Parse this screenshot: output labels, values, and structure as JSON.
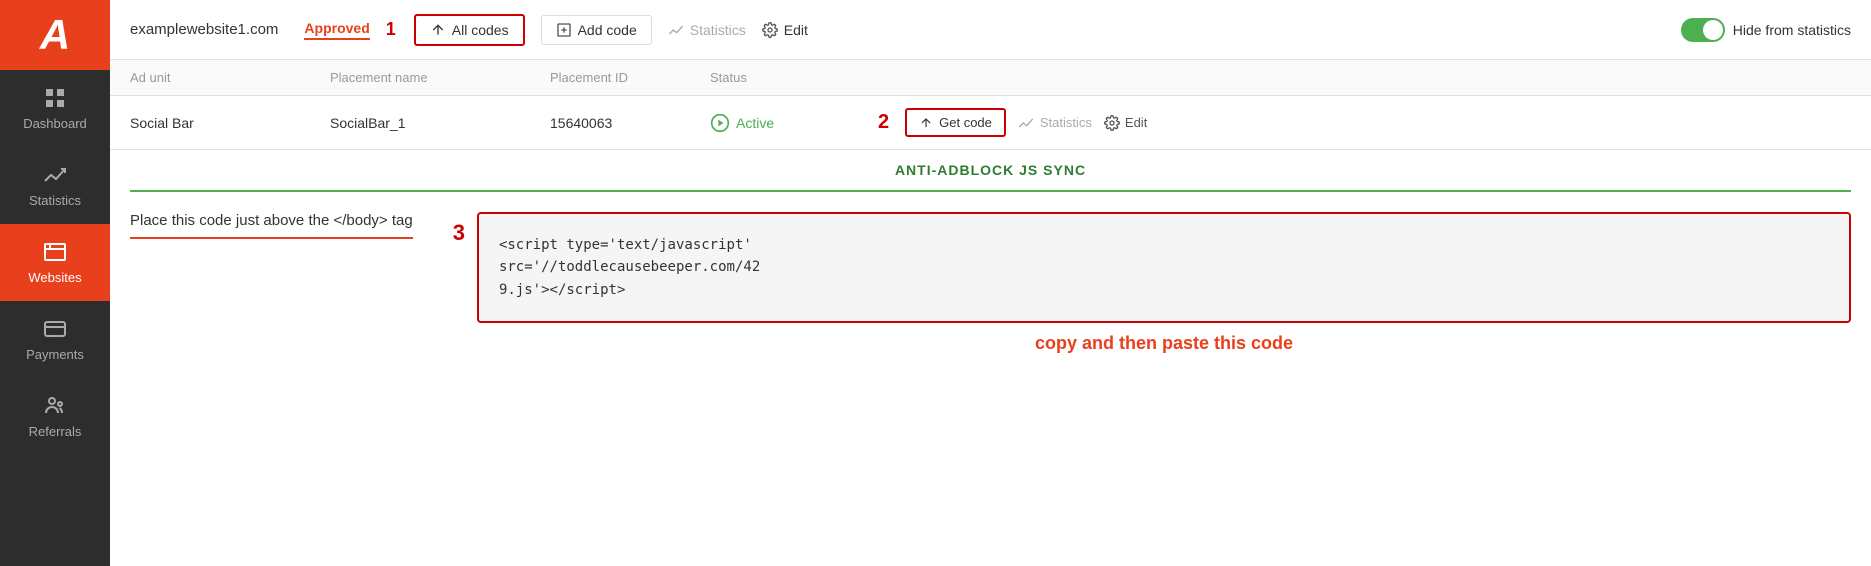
{
  "sidebar": {
    "logo": "A",
    "items": [
      {
        "id": "dashboard",
        "label": "Dashboard",
        "icon": "grid"
      },
      {
        "id": "statistics",
        "label": "Statistics",
        "icon": "chart"
      },
      {
        "id": "websites",
        "label": "Websites",
        "icon": "websites",
        "active": true
      },
      {
        "id": "payments",
        "label": "Payments",
        "icon": "payments"
      },
      {
        "id": "referrals",
        "label": "Referrals",
        "icon": "referrals"
      }
    ]
  },
  "topbar": {
    "domain": "examplewebsite1.com",
    "approved_label": "Approved",
    "step1_num": "1",
    "allcodes_label": "All codes",
    "addcode_label": "Add code",
    "statistics_label": "Statistics",
    "edit_label": "Edit",
    "toggle_label": "Hide from statistics",
    "toggle_on": true
  },
  "table": {
    "headers": {
      "adunit": "Ad unit",
      "placement_name": "Placement name",
      "placement_id": "Placement ID",
      "status": "Status"
    },
    "rows": [
      {
        "adunit": "Social Bar",
        "placement_name": "SocialBar_1",
        "placement_id": "15640063",
        "status": "Active",
        "step2_num": "2",
        "getcode_label": "Get code",
        "statistics_label": "Statistics",
        "edit_label": "Edit"
      }
    ]
  },
  "anti_adblock": {
    "title": "ANTI-ADBLOCK JS SYNC"
  },
  "code_section": {
    "step3_num": "3",
    "instruction": "Place this code just above the </body> tag",
    "code": "<script type='text/javascript'\nsrc='//toddlecausebeeper.com/42\n9.js'></script>",
    "copy_label": "copy and then paste this code"
  }
}
